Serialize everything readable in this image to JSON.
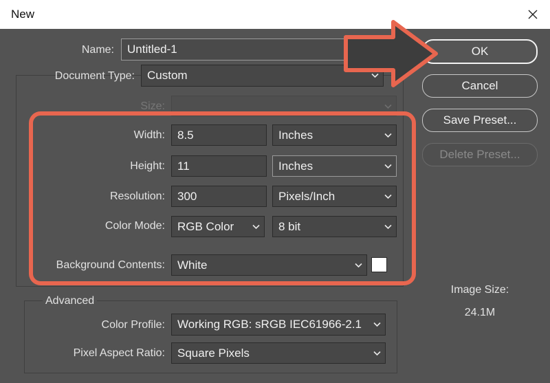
{
  "dialog": {
    "title": "New",
    "name": {
      "label": "Name:",
      "value": "Untitled-1"
    },
    "document_type": {
      "label": "Document Type:",
      "value": "Custom"
    },
    "size": {
      "label": "Size:",
      "value": ""
    },
    "width": {
      "label": "Width:",
      "value": "8.5",
      "unit": "Inches"
    },
    "height": {
      "label": "Height:",
      "value": "11",
      "unit": "Inches"
    },
    "resolution": {
      "label": "Resolution:",
      "value": "300",
      "unit": "Pixels/Inch"
    },
    "color_mode": {
      "label": "Color Mode:",
      "value": "RGB Color",
      "depth": "8 bit"
    },
    "background": {
      "label": "Background Contents:",
      "value": "White",
      "swatch_color": "#ffffff"
    },
    "advanced": {
      "label": "Advanced",
      "color_profile": {
        "label": "Color Profile:",
        "value": "Working RGB:  sRGB IEC61966-2.1"
      },
      "pixel_aspect": {
        "label": "Pixel Aspect Ratio:",
        "value": "Square Pixels"
      }
    },
    "buttons": {
      "ok": "OK",
      "cancel": "Cancel",
      "save_preset": "Save Preset...",
      "delete_preset": "Delete Preset..."
    },
    "image_size": {
      "label": "Image Size:",
      "value": "24.1M"
    }
  },
  "annotations": {
    "highlight_color": "#e8664f",
    "arrow_fill": "#3d3d3d"
  },
  "icons": {
    "close": "close-icon",
    "dropdown": "chevron-down-icon"
  }
}
